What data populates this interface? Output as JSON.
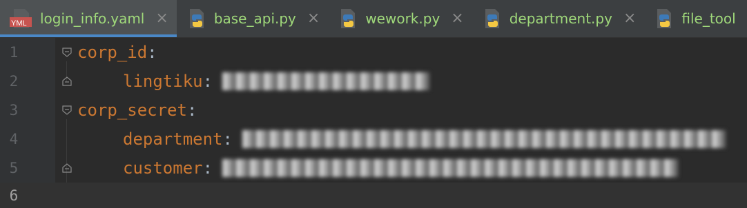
{
  "tabs": [
    {
      "label": "login_info.yaml",
      "type": "yaml",
      "icon_text": "YML",
      "active": true
    },
    {
      "label": "base_api.py",
      "type": "python",
      "active": false
    },
    {
      "label": "wework.py",
      "type": "python",
      "active": false
    },
    {
      "label": "department.py",
      "type": "python",
      "active": false
    },
    {
      "label": "file_tool",
      "type": "python",
      "active": false
    }
  ],
  "close_glyph": "×",
  "editor": {
    "lines": [
      {
        "number": "1",
        "key": "corp_id",
        "colon": ":",
        "value": ""
      },
      {
        "number": "2",
        "key": "lingtiku",
        "colon": ":",
        "value": "wwx1f6cb... (redacted)"
      },
      {
        "number": "3",
        "key": "corp_secret",
        "colon": ":",
        "value": ""
      },
      {
        "number": "4",
        "key": "department",
        "colon": ":",
        "value": "LitJtFvieps... (redacted)"
      },
      {
        "number": "5",
        "key": "customer",
        "colon": ":",
        "value": "..."
      },
      {
        "number": "6",
        "key": "",
        "colon": "",
        "value": ""
      }
    ]
  },
  "colors": {
    "background": "#2b2b2b",
    "tab_bar": "#3c3f41",
    "tab_text": "#9fd87a",
    "key": "#cc7832",
    "active_underline": "#4a88c7"
  }
}
